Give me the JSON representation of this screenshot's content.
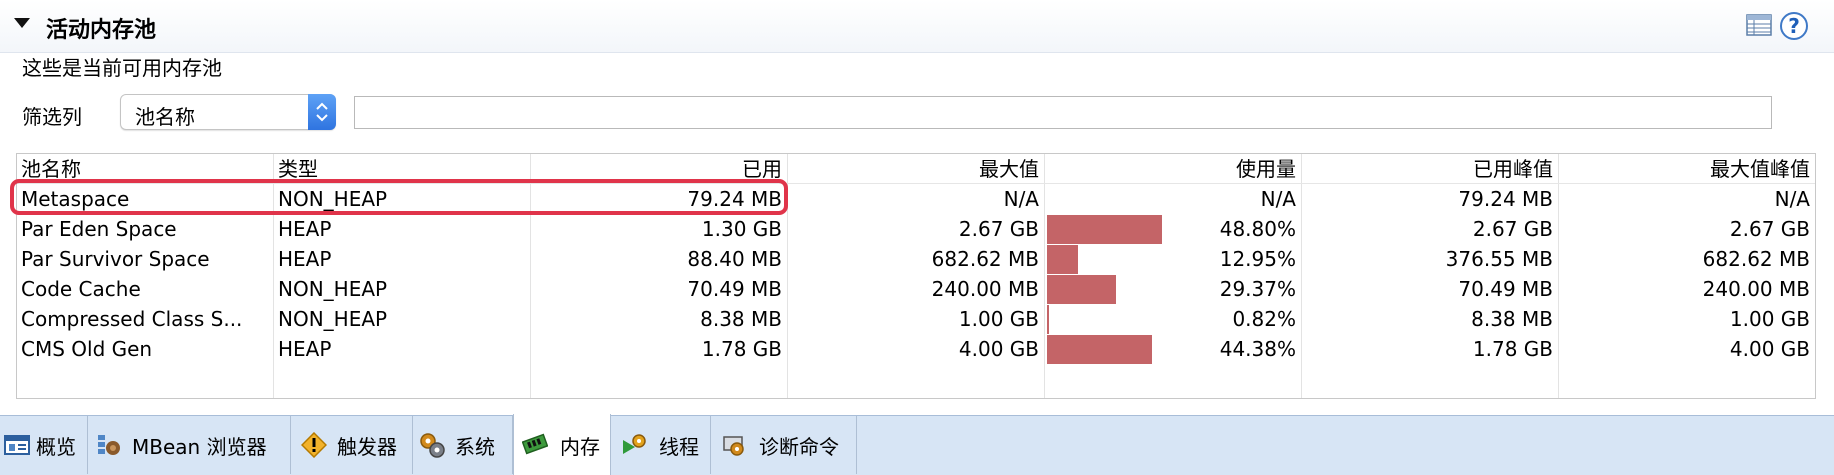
{
  "section": {
    "title": "活动内存池",
    "description": "这些是当前可用内存池"
  },
  "filter": {
    "label": "筛选列",
    "selected_column": "池名称",
    "text_value": ""
  },
  "table": {
    "headers": [
      "池名称",
      "类型",
      "已用",
      "最大值",
      "使用量",
      "已用峰值",
      "最大值峰值"
    ],
    "rows": [
      {
        "name": "Metaspace",
        "type": "NON_HEAP",
        "used": "79.24 MB",
        "max": "N/A",
        "usage": "N/A",
        "usage_fraction": null,
        "peak_used": "79.24 MB",
        "peak_max": "N/A"
      },
      {
        "name": "Par Eden Space",
        "type": "HEAP",
        "used": "1.30 GB",
        "max": "2.67 GB",
        "usage": "48.80%",
        "usage_fraction": 0.488,
        "peak_used": "2.67 GB",
        "peak_max": "2.67 GB"
      },
      {
        "name": "Par Survivor Space",
        "type": "HEAP",
        "used": "88.40 MB",
        "max": "682.62 MB",
        "usage": "12.95%",
        "usage_fraction": 0.1295,
        "peak_used": "376.55 MB",
        "peak_max": "682.62 MB"
      },
      {
        "name": "Code Cache",
        "type": "NON_HEAP",
        "used": "70.49 MB",
        "max": "240.00 MB",
        "usage": "29.37%",
        "usage_fraction": 0.2937,
        "peak_used": "70.49 MB",
        "peak_max": "240.00 MB"
      },
      {
        "name": "Compressed Class S...",
        "type": "NON_HEAP",
        "used": "8.38 MB",
        "max": "1.00 GB",
        "usage": "0.82%",
        "usage_fraction": 0.0082,
        "peak_used": "8.38 MB",
        "peak_max": "1.00 GB"
      },
      {
        "name": "CMS Old Gen",
        "type": "HEAP",
        "used": "1.78 GB",
        "max": "4.00 GB",
        "usage": "44.38%",
        "usage_fraction": 0.4438,
        "peak_used": "1.78 GB",
        "peak_max": "4.00 GB"
      }
    ],
    "highlighted_row": "Metaspace"
  },
  "tabs": [
    {
      "label": "概览",
      "icon": "overview-icon"
    },
    {
      "label": "MBean 浏览器",
      "icon": "mbean-icon"
    },
    {
      "label": "触发器",
      "icon": "trigger-icon"
    },
    {
      "label": "系统",
      "icon": "system-icon"
    },
    {
      "label": "内存",
      "icon": "memory-icon",
      "active": true
    },
    {
      "label": "线程",
      "icon": "thread-icon"
    },
    {
      "label": "诊断命令",
      "icon": "diagnostic-icon"
    }
  ],
  "colors": {
    "usage_bar": "#c46467",
    "highlight": "#e0344a",
    "tabbar": "#d7e5f5"
  }
}
